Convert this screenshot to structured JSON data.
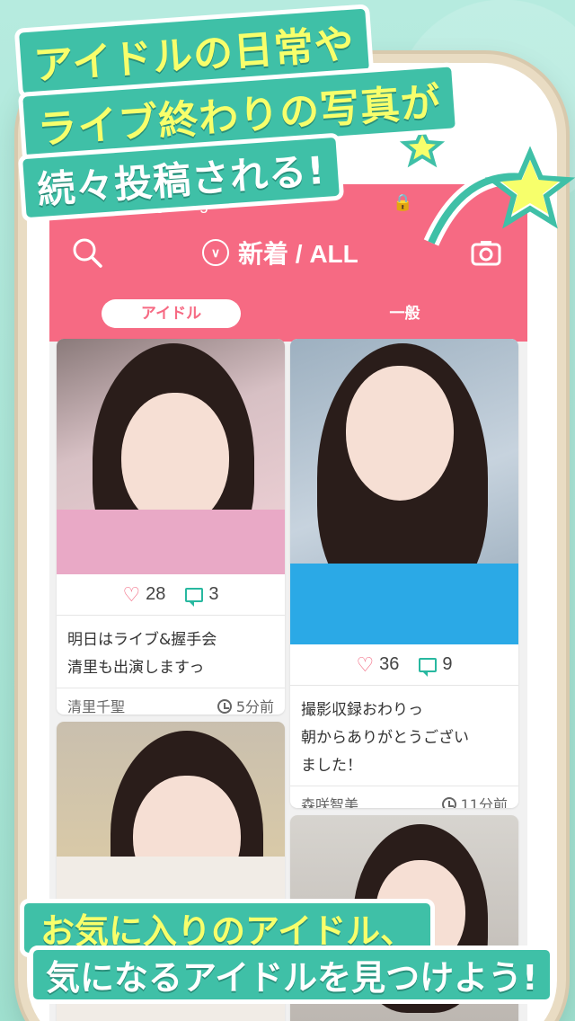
{
  "promo": {
    "line1": "アイドルの日常や",
    "line2": "ライブ終わりの写真が",
    "line3": "続々投稿される!",
    "bottom1": "お気に入りのアイドル、",
    "bottom2": "気になるアイドルを見つけよう!"
  },
  "statusbar": {
    "carrier": "lightning"
  },
  "navbar": {
    "title": "新着 / ALL",
    "search_icon": "search-icon",
    "camera_icon": "camera-icon"
  },
  "tabs": [
    {
      "label": "アイドル",
      "active": true
    },
    {
      "label": "一般",
      "active": false
    }
  ],
  "posts": [
    {
      "likes": "28",
      "comments": "3",
      "caption1": "明日はライブ&握手会",
      "caption2": "清里も出演しますっ",
      "caption3": "",
      "author": "清里千聖",
      "time": "5分前"
    },
    {
      "likes": "36",
      "comments": "9",
      "caption1": "撮影収録おわりっ",
      "caption2": "朝からありがとうござい",
      "caption3": "ました！",
      "author": "森咲智美",
      "time": "11分前"
    }
  ],
  "colors": {
    "accent": "#f66a83",
    "banner": "#3fc0a7",
    "highlight": "#f7ff6b",
    "comment": "#28b8a0"
  }
}
